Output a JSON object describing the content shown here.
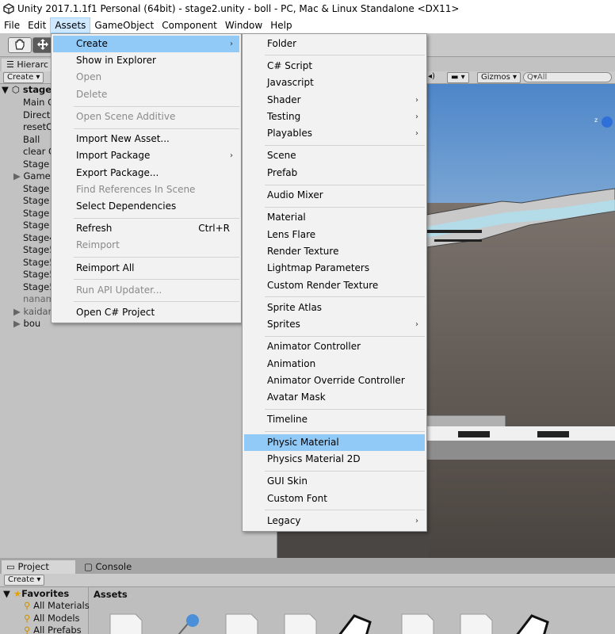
{
  "window": {
    "title": "Unity 2017.1.1f1 Personal (64bit) - stage2.unity - boll - PC, Mac & Linux Standalone <DX11>"
  },
  "menubar": {
    "items": [
      {
        "label": "File"
      },
      {
        "label": "Edit"
      },
      {
        "label": "Assets"
      },
      {
        "label": "GameObject"
      },
      {
        "label": "Component"
      },
      {
        "label": "Window"
      },
      {
        "label": "Help"
      }
    ]
  },
  "hierarchy": {
    "tab_label": "Hierarc",
    "create_label": "Create",
    "scene_name": "stage",
    "items": [
      {
        "label": "Main C"
      },
      {
        "label": "Directi"
      },
      {
        "label": "resetC"
      },
      {
        "label": "Ball"
      },
      {
        "label": "clear C"
      },
      {
        "label": "Stage"
      },
      {
        "label": "Game"
      },
      {
        "label": "Stage"
      },
      {
        "label": "Stage"
      },
      {
        "label": "Stage"
      },
      {
        "label": "Stage"
      },
      {
        "label": "Stage4"
      },
      {
        "label": "Stage5"
      },
      {
        "label": "Stage5"
      },
      {
        "label": "Stage5"
      },
      {
        "label": "Stage5"
      },
      {
        "label": "nanam"
      },
      {
        "label": "kaidar"
      },
      {
        "label": "bou"
      }
    ]
  },
  "scene_toolbar": {
    "gizmos_label": "Gizmos",
    "search_placeholder": "All"
  },
  "assets_menu": {
    "items": [
      {
        "label": "Create",
        "submenu": true
      },
      {
        "label": "Show in Explorer"
      },
      {
        "label": "Open"
      },
      {
        "label": "Delete"
      },
      {
        "label": "Open Scene Additive"
      },
      {
        "label": "Import New Asset..."
      },
      {
        "label": "Import Package",
        "submenu": true
      },
      {
        "label": "Export Package..."
      },
      {
        "label": "Find References In Scene"
      },
      {
        "label": "Select Dependencies"
      },
      {
        "label": "Refresh",
        "shortcut": "Ctrl+R"
      },
      {
        "label": "Reimport"
      },
      {
        "label": "Reimport All"
      },
      {
        "label": "Run API Updater..."
      },
      {
        "label": "Open C# Project"
      }
    ]
  },
  "create_menu": {
    "items": [
      {
        "label": "Folder"
      },
      {
        "label": "C# Script"
      },
      {
        "label": "Javascript"
      },
      {
        "label": "Shader",
        "submenu": true
      },
      {
        "label": "Testing",
        "submenu": true
      },
      {
        "label": "Playables",
        "submenu": true
      },
      {
        "label": "Scene"
      },
      {
        "label": "Prefab"
      },
      {
        "label": "Audio Mixer"
      },
      {
        "label": "Material"
      },
      {
        "label": "Lens Flare"
      },
      {
        "label": "Render Texture"
      },
      {
        "label": "Lightmap Parameters"
      },
      {
        "label": "Custom Render Texture"
      },
      {
        "label": "Sprite Atlas"
      },
      {
        "label": "Sprites",
        "submenu": true
      },
      {
        "label": "Animator Controller"
      },
      {
        "label": "Animation"
      },
      {
        "label": "Animator Override Controller"
      },
      {
        "label": "Avatar Mask"
      },
      {
        "label": "Timeline"
      },
      {
        "label": "Physic Material",
        "highlighted": true
      },
      {
        "label": "Physics Material 2D"
      },
      {
        "label": "GUI Skin"
      },
      {
        "label": "Custom Font"
      },
      {
        "label": "Legacy",
        "submenu": true
      }
    ]
  },
  "project": {
    "tabs": [
      {
        "label": "Project"
      },
      {
        "label": "Console"
      }
    ],
    "create_label": "Create",
    "favorites_label": "Favorites",
    "favorites": [
      {
        "label": "All Materials"
      },
      {
        "label": "All Models"
      },
      {
        "label": "All Prefabs"
      }
    ],
    "assets_header": "Assets"
  },
  "icons": {
    "submenu_arrow": "chevron-right-icon",
    "dropdown_arrow": "caret-down-icon"
  },
  "colors": {
    "menu_highlight": "#91c9f7",
    "menubar_active": "#cde8ff",
    "editor_bg": "#c2c2c2"
  }
}
